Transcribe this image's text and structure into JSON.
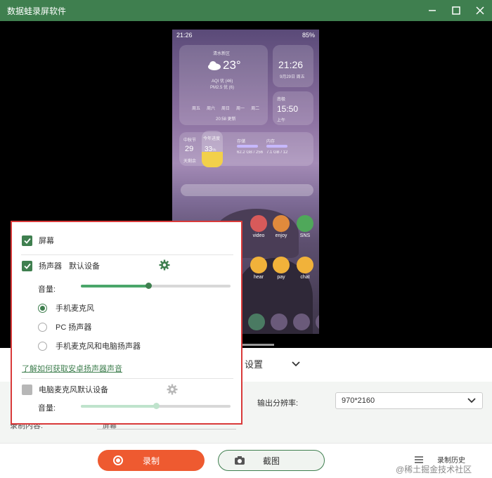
{
  "window": {
    "title": "数据蛙录屏软件"
  },
  "phone": {
    "status_time": "21:26",
    "status_right": "85%",
    "weather": {
      "location": "清水新区",
      "temp": "23°",
      "aqi": "AQI 优 (46)",
      "pm": "PM2.5 优 (6)",
      "days": [
        "周五",
        "周六",
        "周日",
        "周一",
        "周二"
      ],
      "update": "20:58 更新"
    },
    "clock1": {
      "time": "21:26",
      "date": "9月29日 周五"
    },
    "clock2": {
      "label": "南极",
      "time": "15:50",
      "sub": "上午"
    },
    "festival": {
      "title": "中秋节",
      "day": "29",
      "sub": "天剩余"
    },
    "battery": {
      "label": "今年进度",
      "value": "33",
      "unit": "%"
    },
    "storage": {
      "label": "存储",
      "value": "62.2 GB / 256"
    },
    "memory": {
      "label": "内存",
      "value": "7.1 GB / 12"
    },
    "apps": [
      {
        "label": "video"
      },
      {
        "label": "enjoy"
      },
      {
        "label": "SNS"
      },
      {
        "label": "hear"
      },
      {
        "label": "pay"
      },
      {
        "label": "chat"
      }
    ]
  },
  "popup": {
    "screen_label": "屏幕",
    "speaker_label": "扬声器",
    "speaker_device": "默认设备",
    "volume_label": "音量:",
    "volume_level": 0.45,
    "radio_options": [
      "手机麦克风",
      "PC 扬声器",
      "手机麦克风和电脑扬声器"
    ],
    "radio_selected": 0,
    "help_link": "了解如何获取安卓扬声器声音",
    "mic_label": "电脑麦克风",
    "mic_device": "默认设备",
    "mic_volume_label": "音量:",
    "mic_volume_level": 0.5
  },
  "settings": {
    "title": "设置",
    "resolution_label": "输出分辨率:",
    "resolution_value": "970*2160",
    "source_label": "录制内容:",
    "source_value": "屏幕"
  },
  "footer": {
    "record_label": "录制",
    "screenshot_label": "截图",
    "history_label": "录制历史"
  },
  "watermark": "@稀土掘金技术社区",
  "colors": {
    "brand": "#3f7f4f",
    "record": "#ee5a30",
    "highlight": "#d93a3a"
  }
}
